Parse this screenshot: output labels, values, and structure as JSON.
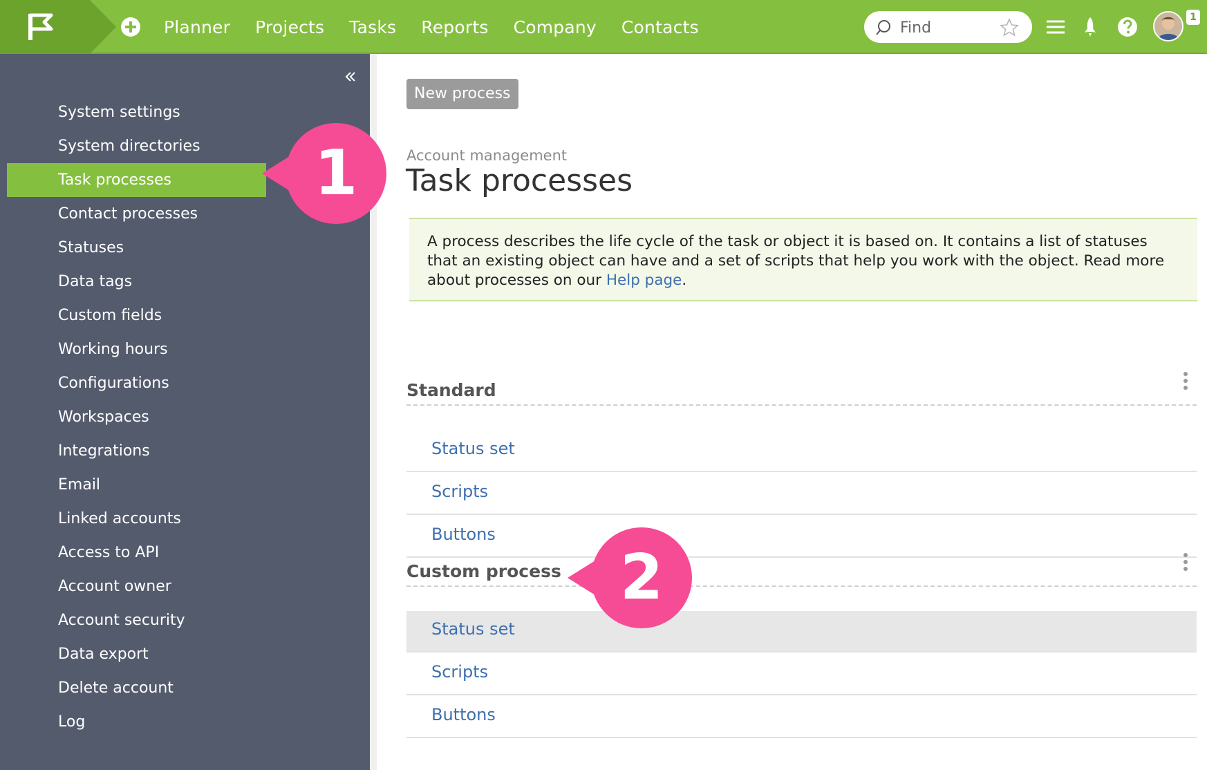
{
  "nav": {
    "items": [
      "Planner",
      "Projects",
      "Tasks",
      "Reports",
      "Company",
      "Contacts"
    ]
  },
  "search": {
    "placeholder": "Find"
  },
  "notifications": {
    "count": "1"
  },
  "sidebar": {
    "items": [
      {
        "label": "System settings"
      },
      {
        "label": "System directories"
      },
      {
        "label": "Task processes",
        "active": true
      },
      {
        "label": "Contact processes"
      },
      {
        "label": "Statuses"
      },
      {
        "label": "Data tags"
      },
      {
        "label": "Custom fields"
      },
      {
        "label": "Working hours"
      },
      {
        "label": "Configurations"
      },
      {
        "label": "Workspaces"
      },
      {
        "label": "Integrations"
      },
      {
        "label": "Email"
      },
      {
        "label": "Linked accounts"
      },
      {
        "label": "Access to API"
      },
      {
        "label": "Account owner"
      },
      {
        "label": "Account security"
      },
      {
        "label": "Data export"
      },
      {
        "label": "Delete account"
      },
      {
        "label": "Log"
      }
    ]
  },
  "main": {
    "new_button": "New process",
    "breadcrumb": "Account management",
    "title": "Task processes",
    "info_text": "A process describes the life cycle of the task or object it is based on. It contains a list of statuses that an existing object can have and a set of scripts that help you work with the object. Read more about processes on our ",
    "info_link": "Help page",
    "info_end": ".",
    "sections": [
      {
        "name": "Standard",
        "links": [
          "Status set",
          "Scripts",
          "Buttons"
        ]
      },
      {
        "name": "Custom process",
        "links": [
          "Status set",
          "Scripts",
          "Buttons"
        ]
      }
    ]
  },
  "callouts": [
    "1",
    "2"
  ],
  "colors": {
    "brand_green": "#85bf3f",
    "sidebar_bg": "#545b6d",
    "callout_pink": "#f64b95",
    "link_blue": "#3d6fb0"
  }
}
